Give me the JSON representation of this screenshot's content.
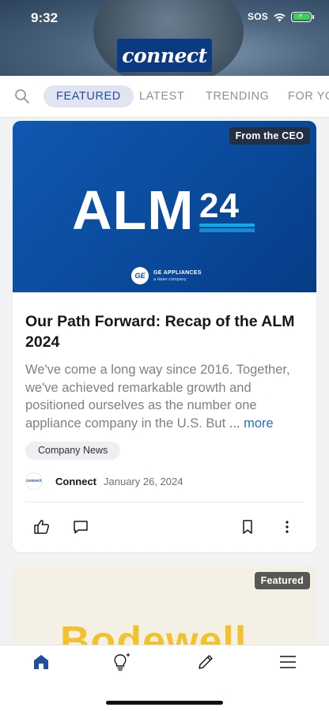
{
  "status_bar": {
    "time": "9:32",
    "carrier": "SOS"
  },
  "app": {
    "logo_text": "connect"
  },
  "tabs": [
    {
      "label": "FEATURED",
      "active": true
    },
    {
      "label": "LATEST",
      "active": false
    },
    {
      "label": "TRENDING",
      "active": false
    },
    {
      "label": "FOR YO",
      "active": false
    }
  ],
  "posts": [
    {
      "badge": "From the CEO",
      "hero": {
        "main": "ALM",
        "number": "24",
        "brand": "GE APPLIANCES",
        "brand_sub": "a Haier company"
      },
      "title": "Our Path Forward: Recap of the ALM 2024",
      "excerpt": "We've come a long way since 2016. Together, we've achieved remarkable growth and positioned ourselves as the number one appliance company in the U.S. But",
      "more_label": "... more",
      "tag": "Company News",
      "author": "Connect",
      "date": "January 26, 2024",
      "avatar_text": "connect"
    },
    {
      "badge": "Featured",
      "hero_text": "Bodewell"
    }
  ],
  "colors": {
    "accent": "#1f4fa3",
    "hero_blue": "#0a4a9c",
    "link": "#1f6fd1"
  },
  "icons": [
    "search-icon",
    "like-icon",
    "comment-icon",
    "bookmark-icon",
    "more-vertical-icon",
    "home-icon",
    "ideas-icon",
    "edit-icon",
    "menu-icon"
  ]
}
